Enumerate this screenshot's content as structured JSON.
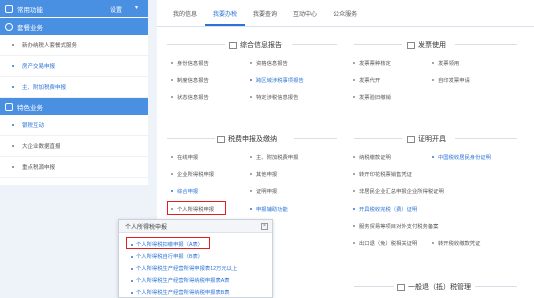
{
  "sidebar": {
    "header1": {
      "label": "常用功能",
      "setting": "设置",
      "chev": "▾"
    },
    "group1": {
      "label": "套餐业务"
    },
    "group1_items": [
      {
        "label": "新办纳税人套餐式服务",
        "hl": false
      },
      {
        "label": "房产交易申报",
        "hl": true
      },
      {
        "label": "主、附加税费申报",
        "hl": true
      }
    ],
    "group2": {
      "label": "特色业务"
    },
    "group2_items": [
      {
        "label": "银税互动",
        "hl": true
      },
      {
        "label": "大企业数据直报",
        "hl": false
      },
      {
        "label": "重点税源申报",
        "hl": false
      }
    ]
  },
  "tabs": [
    "我的信息",
    "我要办税",
    "我要查询",
    "互动中心",
    "公众服务"
  ],
  "active_tab": 1,
  "sections": {
    "info_report": "综合信息报告",
    "invoice": "发票使用",
    "tax_declare": "税费申报及缴纳",
    "certificate": "证明开具",
    "general_mgmt": "一般退（抵）税管理"
  },
  "info_links": {
    "left": [
      "身份信息报告",
      "制度信息报告",
      "状态信息报告"
    ],
    "mid": [
      "资格信息报告",
      "跨区域涉税事项报告",
      "特定涉税信息报告"
    ]
  },
  "invoice_links": {
    "left": [
      "发票票种核定",
      "发票代开",
      "发票验旧缴销"
    ],
    "right": [
      "发票领用",
      "自印发票申请"
    ]
  },
  "declare_links": {
    "left": [
      "在线申报",
      "企业所得税申报",
      "综合申报",
      "个人所得税申报"
    ],
    "mid": [
      "主、附加税费申报",
      "其他申报",
      "证明申报",
      "申报辅助功能"
    ]
  },
  "cert_links": [
    {
      "label": "纳税缴款证明",
      "blue": false
    },
    {
      "label": "中国税收居民身份证明",
      "blue": true
    },
    {
      "label": "转开印花税票销售凭证",
      "blue": false
    },
    {
      "label": "非居民企业汇总申报企业所得税证明",
      "blue": false
    },
    {
      "label": "开具税收完税（费）证明",
      "blue": true
    },
    {
      "label": "服务贸易等项目对外支付税务备案",
      "blue": false
    },
    {
      "label": "出口退（免）税相关证明",
      "blue": false
    },
    {
      "label": "转开税收缴款凭证",
      "blue": false
    }
  ],
  "popup": {
    "title": "个人所得税申报",
    "close": "×",
    "items": [
      "个人所得税扣缴申报（A表）",
      "个人所得税自行申报（B表）",
      "个人所得税生产经营所得申报表12万元以上",
      "个人所得税生产经营所得纳税申报表A表",
      "个人所得税生产经营所得纳税申报表B表"
    ]
  }
}
